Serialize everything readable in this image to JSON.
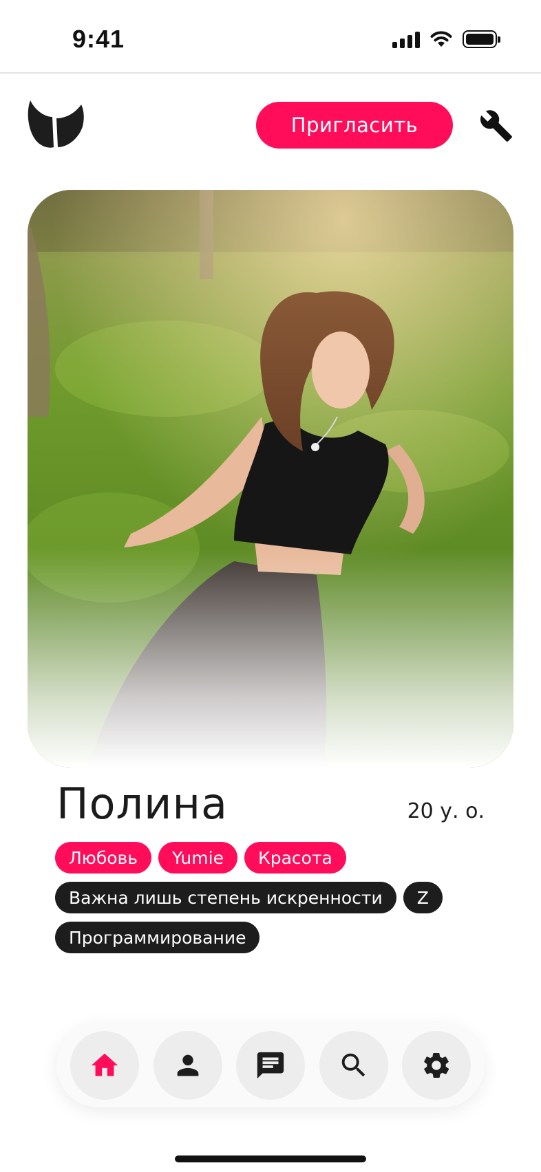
{
  "status_bar": {
    "time": "9:41"
  },
  "header": {
    "invite_label": "Пригласить"
  },
  "profile": {
    "name": "Полина",
    "age": "20 у. о.",
    "tags": [
      [
        {
          "label": "Любовь",
          "style": "pink"
        },
        {
          "label": "Yumie",
          "style": "pink"
        },
        {
          "label": "Красота",
          "style": "pink"
        }
      ],
      [
        {
          "label": "Важна лишь степень искренности",
          "style": "dark"
        },
        {
          "label": "Z",
          "style": "dark"
        }
      ],
      [
        {
          "label": "Программирование",
          "style": "dark"
        }
      ]
    ]
  },
  "nav": {
    "items": [
      {
        "name": "home",
        "active": true
      },
      {
        "name": "profile",
        "active": false
      },
      {
        "name": "messages",
        "active": false
      },
      {
        "name": "search",
        "active": false
      },
      {
        "name": "settings",
        "active": false
      }
    ]
  },
  "colors": {
    "accent": "#ff0d5a",
    "dark": "#1d1d1d",
    "nav_bg": "#ededed"
  }
}
